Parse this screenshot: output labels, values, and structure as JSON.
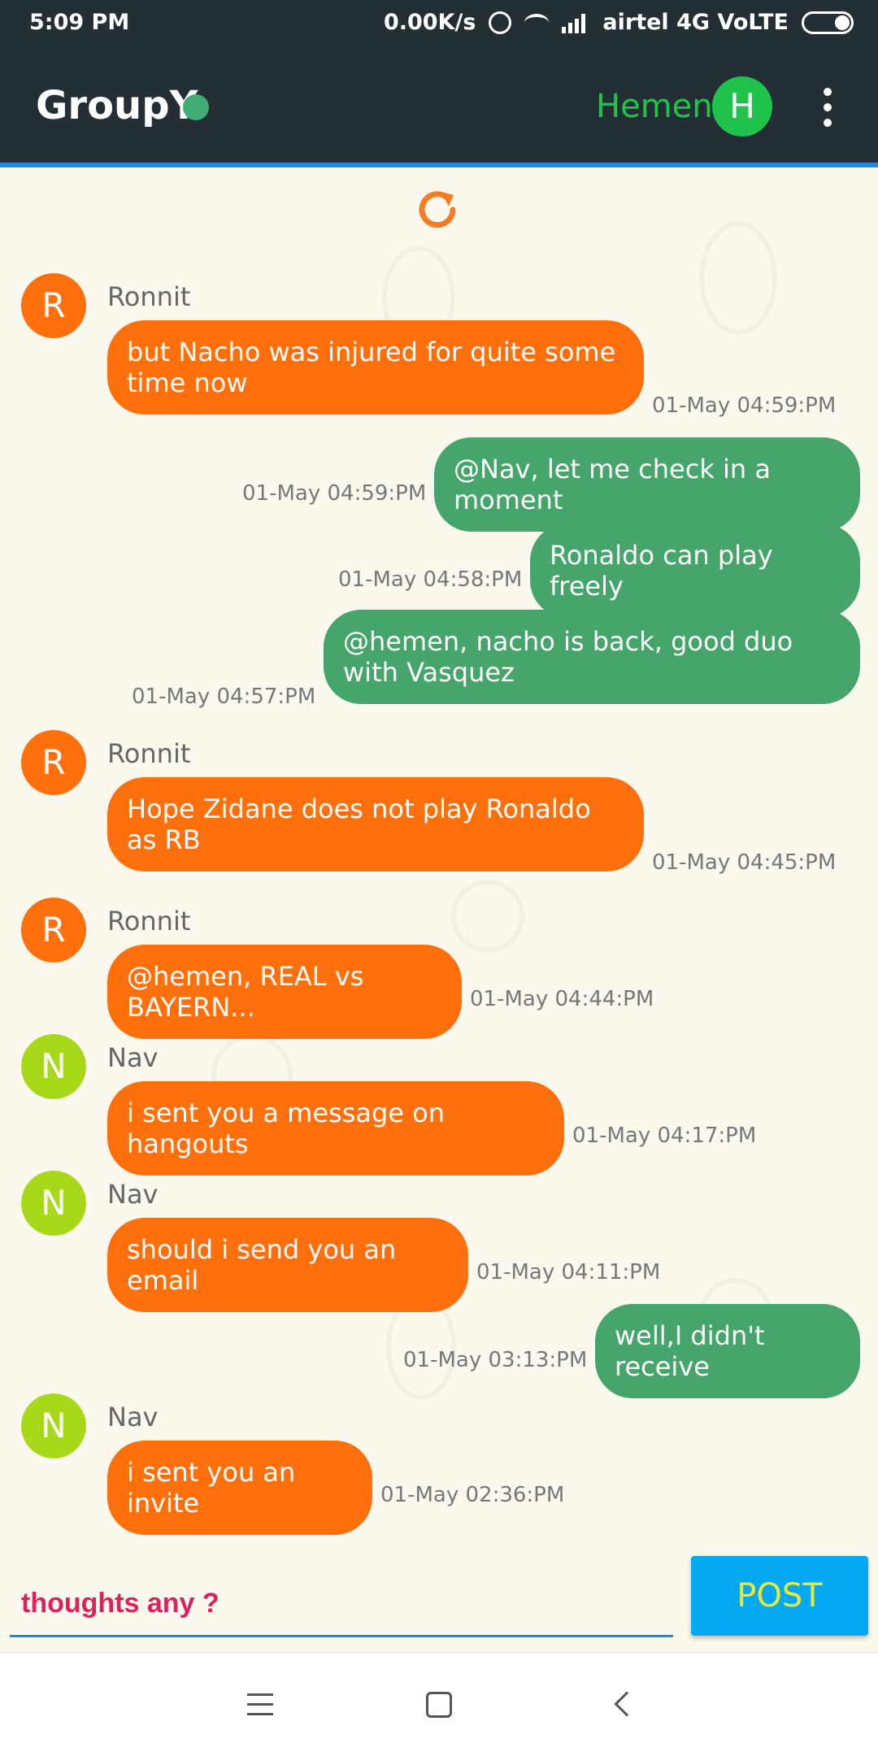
{
  "status_bar": {
    "time": "5:09 PM",
    "speed": "0.00K/s",
    "carrier": "airtel 4G VoLTE"
  },
  "app_bar": {
    "title": "GroupY",
    "user_name": "Hemen",
    "user_initial": "H",
    "online_color": "#3fae75"
  },
  "messages": [
    {
      "type": "incoming",
      "initial": "R",
      "sender": "Ronnit",
      "text": "but Nacho was injured for quite some time now",
      "time": "01-May 04:59:PM",
      "avatar_color": "#ff6f0c"
    },
    {
      "type": "outgoing",
      "text": "@Nav, let me check in a moment",
      "time": "01-May 04:59:PM"
    },
    {
      "type": "outgoing",
      "text": "Ronaldo can play freely",
      "time": "01-May 04:58:PM"
    },
    {
      "type": "outgoing",
      "text": "@hemen, nacho is back, good duo with Vasquez",
      "time": "01-May 04:57:PM"
    },
    {
      "type": "incoming",
      "initial": "R",
      "sender": "Ronnit",
      "text": "Hope Zidane does not play Ronaldo as RB",
      "time": "01-May 04:45:PM",
      "avatar_color": "#ff6f0c"
    },
    {
      "type": "incoming",
      "initial": "R",
      "sender": "Ronnit",
      "text": "@hemen, REAL vs BAYERN...",
      "time": "01-May 04:44:PM",
      "avatar_color": "#ff6f0c"
    },
    {
      "type": "incoming",
      "initial": "N",
      "sender": "Nav",
      "text": "i sent you a message on hangouts",
      "time": "01-May 04:17:PM",
      "avatar_color": "#a8d81a"
    },
    {
      "type": "incoming",
      "initial": "N",
      "sender": "Nav",
      "text": "should i send you an email",
      "time": "01-May 04:11:PM",
      "avatar_color": "#a8d81a"
    },
    {
      "type": "outgoing",
      "text": "well,I didn't receive",
      "time": "01-May 03:13:PM"
    },
    {
      "type": "incoming",
      "initial": "N",
      "sender": "Nav",
      "text": "i sent you an invite",
      "time": "01-May 02:36:PM",
      "avatar_color": "#a8d81a"
    }
  ],
  "composer": {
    "placeholder": "thoughts any ?",
    "post_label": "POST"
  },
  "colors": {
    "incoming_bubble": "#ff6f0c",
    "outgoing_bubble": "#45a56b",
    "accent": "#05a9f1"
  }
}
